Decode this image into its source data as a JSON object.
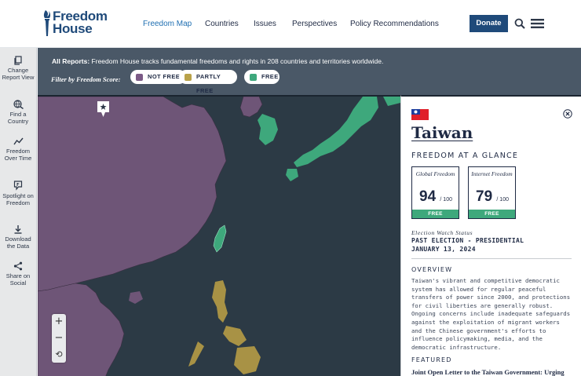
{
  "header": {
    "logo_line1": "Freedom",
    "logo_line2": "House",
    "nav": [
      {
        "label": "Freedom Map"
      },
      {
        "label": "Countries"
      },
      {
        "label": "Issues"
      },
      {
        "label": "Perspectives"
      },
      {
        "label": "Policy Recommendations"
      }
    ],
    "donate_label": "Donate",
    "brand_color": "#1f4a7a",
    "active_nav_color": "#1f6fb2"
  },
  "toolbar": {
    "items": [
      {
        "label": "Change Report View",
        "icon": "copy-icon"
      },
      {
        "label": "Find a Country",
        "icon": "globe-search-icon"
      },
      {
        "label": "Freedom Over Time",
        "icon": "trend-line-icon"
      },
      {
        "label": "Spotlight on Freedom",
        "icon": "speech-flag-icon"
      },
      {
        "label": "Download the Data",
        "icon": "download-icon"
      },
      {
        "label": "Share on Social",
        "icon": "share-icon"
      }
    ]
  },
  "filterbar": {
    "all_reports_label": "All Reports:",
    "all_reports_text": "Freedom House tracks fundamental freedoms and rights in 208 countries and territories worldwide.",
    "filter_label": "Filter by Freedom Score:",
    "pills": [
      {
        "label": "NOT FREE",
        "color": "#7b5a86"
      },
      {
        "label": "PARTLY FREE",
        "color": "#b9a24a"
      },
      {
        "label": "FREE",
        "color": "#3ea87c"
      }
    ],
    "background": "#4a5867"
  },
  "map": {
    "zoom_in": "+",
    "zoom_out": "−",
    "reset": "⟲",
    "colors": {
      "sea": "#2c3a45",
      "not_free": "#6e5577",
      "partly_free": "#a89245",
      "free": "#3ea87c"
    }
  },
  "panel": {
    "country": "Taiwan",
    "glance_title": "FREEDOM AT A GLANCE",
    "scores": [
      {
        "title": "Global Freedom",
        "score": "94",
        "max": "/ 100",
        "status": "FREE"
      },
      {
        "title": "Internet Freedom",
        "score": "79",
        "max": "/ 100",
        "status": "FREE"
      }
    ],
    "election_label": "Election Watch Status",
    "election_line1": "PAST ELECTION - PRESIDENTIAL",
    "election_line2": "JANUARY 13, 2024",
    "overview_title": "OVERVIEW",
    "overview_text": "Taiwan's vibrant and competitive democratic system has allowed for regular peaceful transfers of power since 2000, and protections for civil liberties are generally robust. Ongoing concerns include inadequate safeguards against the exploitation of migrant workers and the Chinese government's efforts to influence policymaking, media, and the democratic infrastructure.",
    "featured_title": "FEATURED",
    "featured_link": "Joint Open Letter to the Taiwan Government: Urging",
    "status_color": "#3ea87c"
  }
}
